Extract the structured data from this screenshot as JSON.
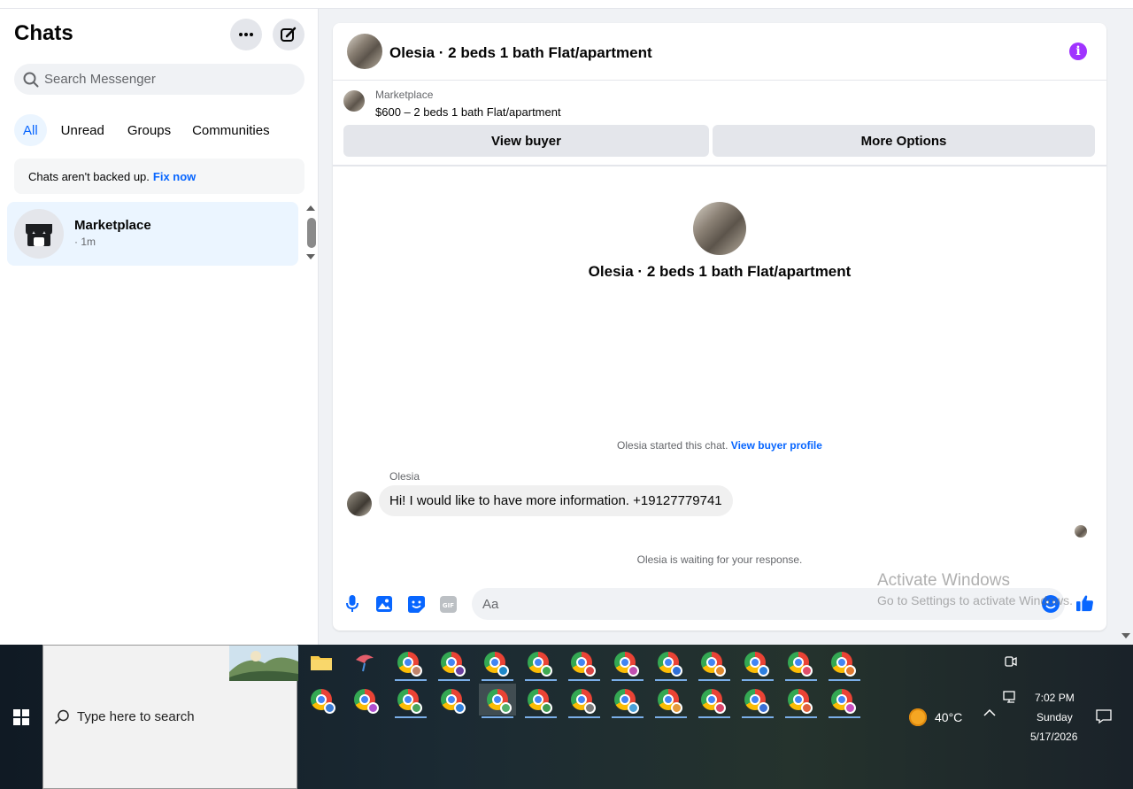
{
  "left": {
    "title": "Chats",
    "search_placeholder": "Search Messenger",
    "filters": [
      "All",
      "Unread",
      "Groups",
      "Communities"
    ],
    "backup_text": "Chats aren't backed up.",
    "backup_link": "Fix now",
    "chat_item": {
      "name": "Marketplace",
      "time": "· 1m"
    }
  },
  "conversation": {
    "title": "Olesia · 2 beds 1 bath Flat/apartment",
    "marketplace_label": "Marketplace",
    "listing": "$600 – 2 beds 1 bath Flat/apartment",
    "view_buyer": "View buyer",
    "more_options": "More Options",
    "big_title": "Olesia · 2 beds 1 bath Flat/apartment",
    "started_text": "Olesia started this chat.",
    "view_buyer_profile": "View buyer profile",
    "sender": "Olesia",
    "message": "Hi! I would like to have more information. +19127779741",
    "waiting": "Olesia is waiting for your response.",
    "compose_placeholder": "Aa",
    "accent_color": "#0866ff",
    "info_color": "#a033ff"
  },
  "watermark": {
    "line1": "Activate Windows",
    "line2": "Go to Settings to activate Windows."
  },
  "taskbar": {
    "search_placeholder": "Type here to search",
    "temperature": "40°C",
    "time": "7:02 PM",
    "day": "Sunday",
    "date": "5/17/2026"
  }
}
